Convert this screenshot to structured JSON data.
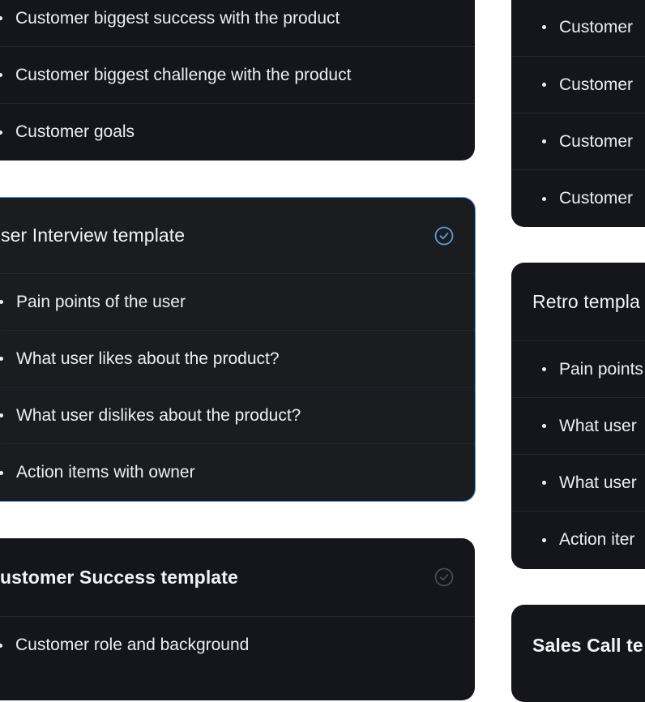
{
  "cards_left": {
    "top_card": {
      "items": [
        "Customer biggest success with the product",
        "Customer biggest challenge with the product",
        "Customer goals"
      ]
    },
    "user_interview": {
      "title": "ser Interview template",
      "selected": true,
      "items": [
        "Pain points of the user",
        "What user likes about the product?",
        "What user dislikes about the product?",
        "Action items with owner"
      ]
    },
    "customer_success": {
      "title": "ustomer Success template",
      "selected": false,
      "items": [
        "Customer role and background"
      ]
    }
  },
  "cards_right": {
    "top_card": {
      "items": [
        "Customer",
        "Customer",
        "Customer",
        "Customer"
      ]
    },
    "retro": {
      "title": "Retro templa",
      "items": [
        "Pain points",
        "What user",
        "What user",
        "Action iter"
      ]
    },
    "sales_call": {
      "title": "Sales Call te"
    }
  },
  "colors": {
    "card_bg": "#15161b",
    "selected_border": "#4f8fd6",
    "check_selected": "#5b9be0",
    "check_unselected": "#4a4b52"
  }
}
